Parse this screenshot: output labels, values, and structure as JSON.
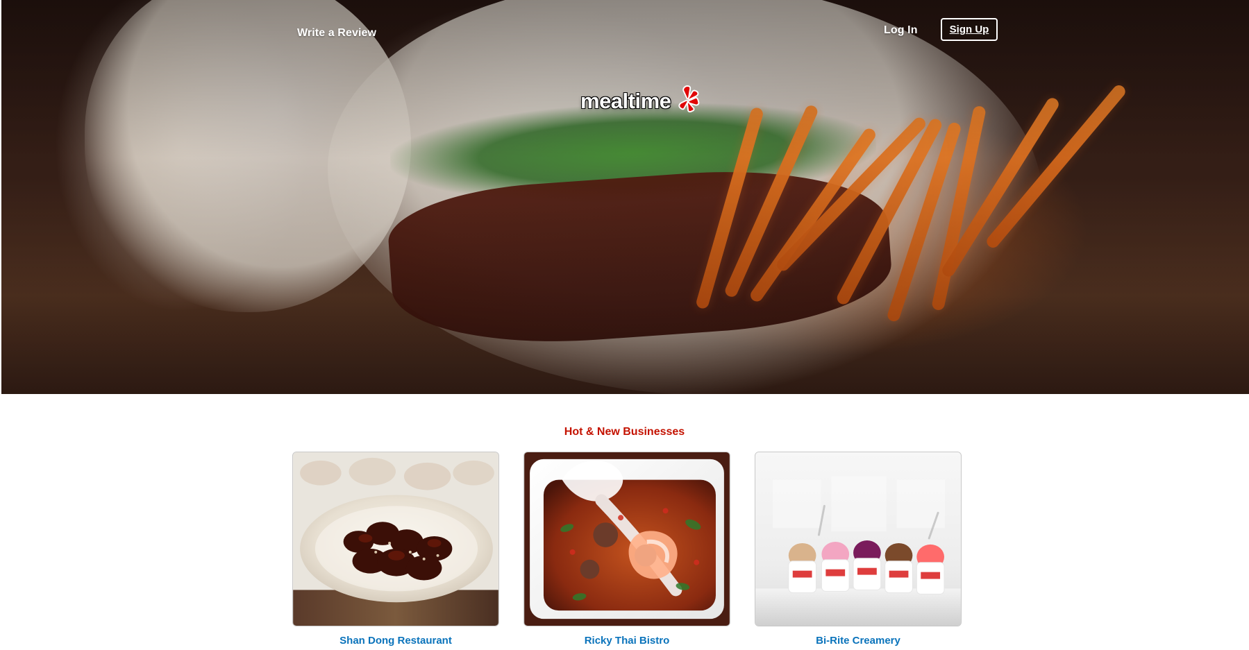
{
  "brand": {
    "name": "mealtime",
    "accent_color": "#c41200"
  },
  "header": {
    "write_review_label": "Write a Review",
    "login_label": "Log In",
    "signup_label": "Sign Up"
  },
  "hot_and_new": {
    "title": "Hot & New Businesses",
    "title_color": "#c41200",
    "businesses": [
      {
        "name": "Shan Dong Restaurant"
      },
      {
        "name": "Ricky Thai Bistro"
      },
      {
        "name": "Bi-Rite Creamery"
      }
    ],
    "link_color": "#0a73bb"
  },
  "icons": {
    "logo_burst": "yelp-burst-icon"
  }
}
